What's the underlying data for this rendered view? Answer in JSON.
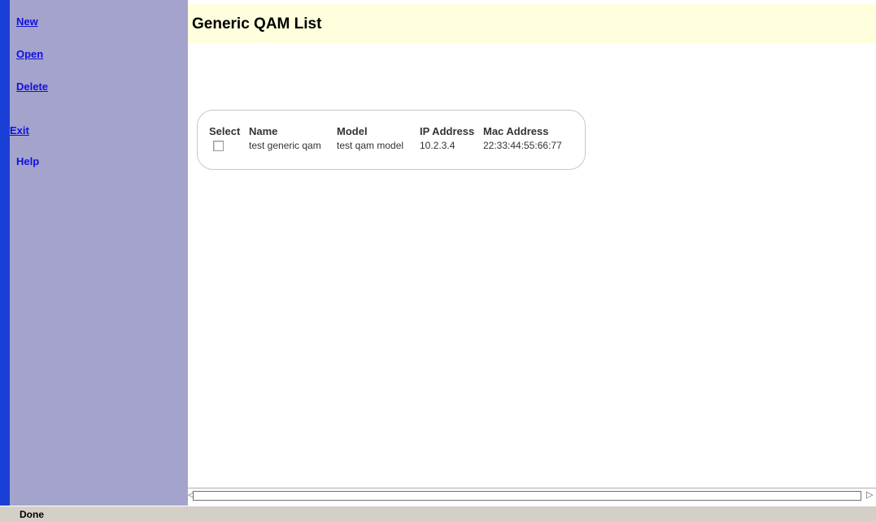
{
  "sidebar": {
    "items": [
      {
        "label": "New"
      },
      {
        "label": "Open"
      },
      {
        "label": "Delete"
      },
      {
        "label": "Exit"
      },
      {
        "label": "Help"
      }
    ]
  },
  "main": {
    "title": "Generic QAM List",
    "table": {
      "headers": [
        "Select",
        "Name",
        "Model",
        "IP Address",
        "Mac Address"
      ],
      "rows": [
        {
          "selected": false,
          "name": "test generic qam",
          "model": "test qam model",
          "ip": "10.2.3.4",
          "mac": "22:33:44:55:66:77"
        }
      ]
    }
  },
  "status_bar": {
    "text": "Done"
  },
  "colors": {
    "sidebar_bg": "#a3a3cc",
    "window_edge": "#1a3fd6",
    "link": "#1010e0",
    "title_bg": "#ffffdd",
    "status_bg": "#d4d0c8"
  },
  "icons": {
    "scroll_left": "scroll-left-arrow-icon",
    "scroll_right": "scroll-right-arrow-icon"
  }
}
